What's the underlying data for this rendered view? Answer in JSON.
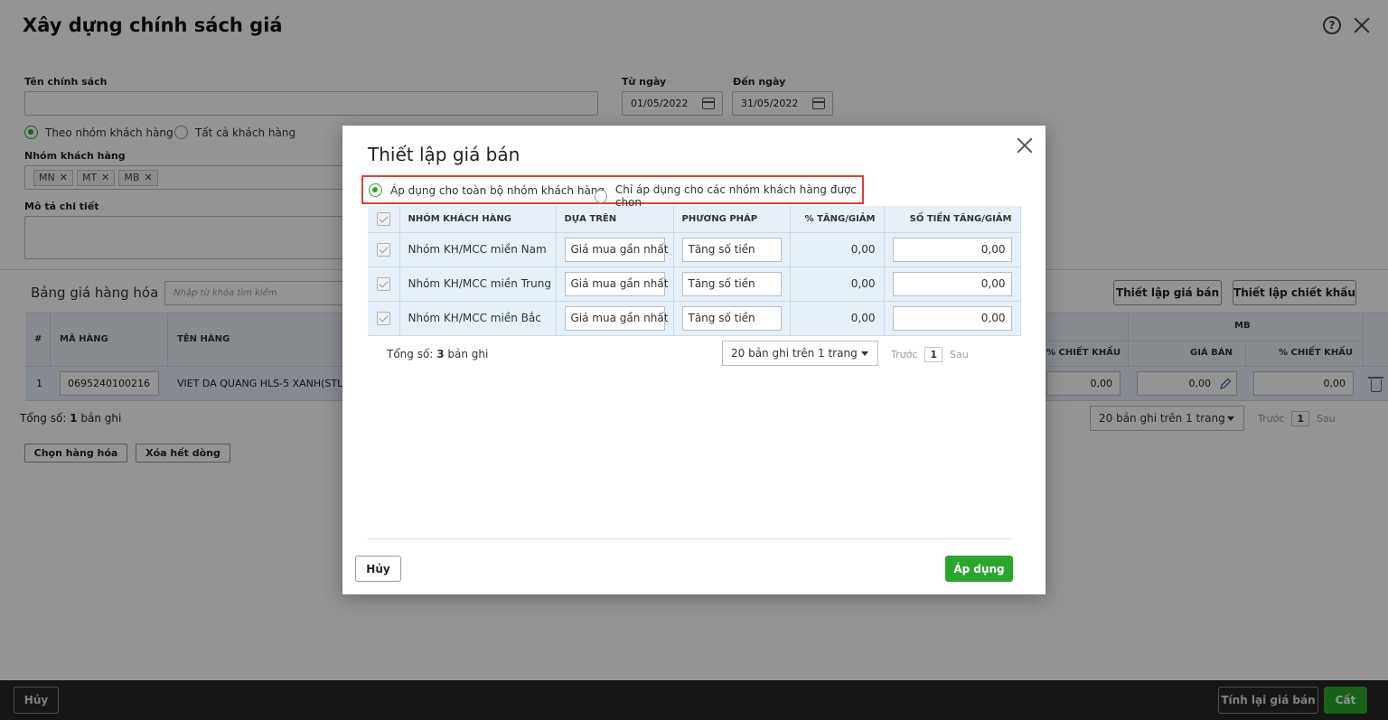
{
  "page": {
    "title": "Xây dựng chính sách giá",
    "policy_name_label": "Tên chính sách",
    "policy_name_value": "",
    "from_date_label": "Từ ngày",
    "from_date": "01/05/2022",
    "to_date_label": "Đến ngày",
    "to_date": "31/05/2022",
    "radio_group": "Theo nhóm khách hàng",
    "radio_all": "Tất cả khách hàng",
    "customer_group_label": "Nhóm khách hàng",
    "customer_tags": [
      "MN",
      "MT",
      "MB"
    ],
    "description_label": "Mô tả chi tiết"
  },
  "price_table": {
    "title": "Bảng giá hàng hóa",
    "search_placeholder": "Nhập từ khóa tìm kiếm",
    "setup_price_button": "Thiết lập giá bán",
    "setup_discount_button": "Thiết lập chiết khấu",
    "columns": {
      "index": "#",
      "code": "MÃ HÀNG",
      "name": "TÊN HÀNG",
      "discount": "% CHIẾT KHẤU",
      "group_mb": "MB",
      "price": "GIÁ BÁN",
      "discount2": "% CHIẾT KHẤU"
    },
    "row": {
      "index": "1",
      "code": "0695240100216",
      "name": "VIET DA QUANG HLS-5 XANH(STLO",
      "discount": "0,00",
      "price": "0,00",
      "discount2": "0,00"
    },
    "total_prefix": "Tổng số:",
    "total_count": "1",
    "total_suffix": "bản ghi",
    "page_size": "20 bản ghi trên 1 trang",
    "prev": "Trước",
    "page": "1",
    "next": "Sau",
    "choose_goods_button": "Chọn hàng hóa",
    "delete_all_button": "Xóa hết dòng"
  },
  "footer": {
    "cancel_button": "Hủy",
    "recalc_button": "Tính lại giá bán",
    "save_button": "Cất"
  },
  "modal": {
    "title": "Thiết lập giá bán",
    "apply_all_option": "Áp dụng cho toàn bộ nhóm khách hàng",
    "apply_selected_option": "Chỉ áp dụng cho các nhóm khách hàng được chọn",
    "columns": {
      "group": "NHÓM KHÁCH HÀNG",
      "based_on": "DỰA TRÊN",
      "method": "PHƯƠNG PHÁP",
      "percent": "% TĂNG/GIẢM",
      "amount": "SỐ TIỀN TĂNG/GIẢM"
    },
    "rows": [
      {
        "group": "Nhóm KH/MCC miền Nam",
        "based_on": "Giá mua gần nhất",
        "method": "Tăng số tiền",
        "percent": "0,00",
        "amount": "0,00"
      },
      {
        "group": "Nhóm KH/MCC miền Trung",
        "based_on": "Giá mua gần nhất",
        "method": "Tăng số tiền",
        "percent": "0,00",
        "amount": "0,00"
      },
      {
        "group": "Nhóm KH/MCC miền Bắc",
        "based_on": "Giá mua gần nhất",
        "method": "Tăng số tiền",
        "percent": "0,00",
        "amount": "0,00"
      }
    ],
    "total_prefix": "Tổng số:",
    "total_count": "3",
    "total_suffix": "bản ghi",
    "page_size": "20 bản ghi trên 1 trang",
    "prev": "Trước",
    "page": "1",
    "next": "Sau",
    "cancel_button": "Hủy",
    "apply_button": "Áp dụng"
  },
  "colors": {
    "accent": "#2ba52b",
    "highlight_border": "#d9453b",
    "header_bg": "#e8eff8",
    "row_bg": "#e5f0fa"
  }
}
